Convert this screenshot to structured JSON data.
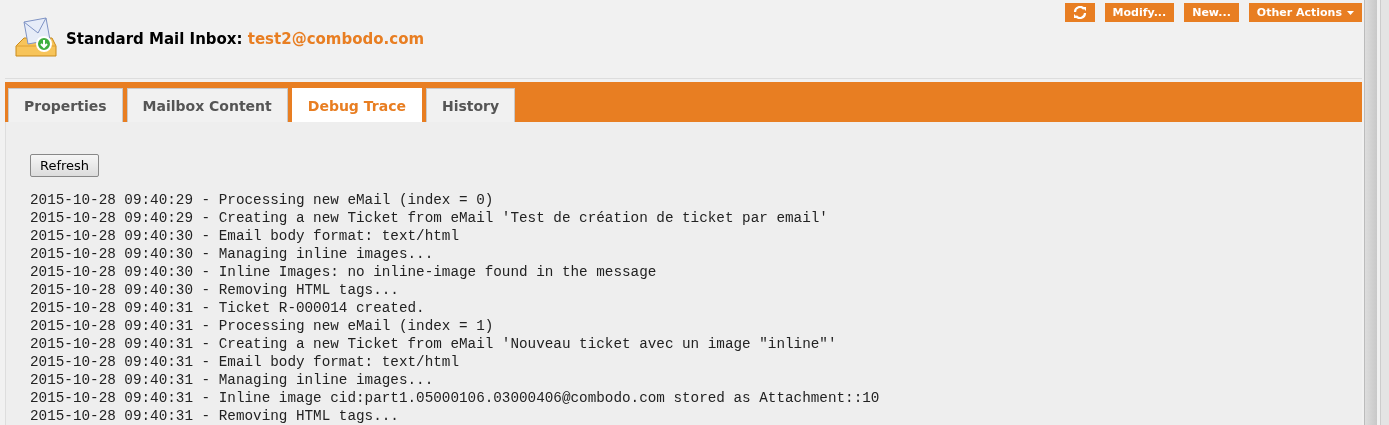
{
  "header": {
    "title_label": "Standard Mail Inbox:",
    "title_value": "test2@combodo.com"
  },
  "actions": [
    {
      "kind": "refresh"
    },
    {
      "kind": "text",
      "label": "Modify..."
    },
    {
      "kind": "text",
      "label": "New..."
    },
    {
      "kind": "menu",
      "label": "Other Actions"
    }
  ],
  "tabs": [
    {
      "label": "Properties",
      "selected": false
    },
    {
      "label": "Mailbox Content",
      "selected": false
    },
    {
      "label": "Debug Trace",
      "selected": true
    },
    {
      "label": "History",
      "selected": false
    }
  ],
  "refresh_button": "Refresh",
  "log_lines": [
    "2015-10-28 09:40:29 - Processing new eMail (index = 0)",
    "2015-10-28 09:40:29 - Creating a new Ticket from eMail 'Test de création de ticket par email'",
    "2015-10-28 09:40:30 - Email body format: text/html",
    "2015-10-28 09:40:30 - Managing inline images...",
    "2015-10-28 09:40:30 - Inline Images: no inline-image found in the message",
    "2015-10-28 09:40:30 - Removing HTML tags...",
    "2015-10-28 09:40:31 - Ticket R-000014 created.",
    "2015-10-28 09:40:31 - Processing new eMail (index = 1)",
    "2015-10-28 09:40:31 - Creating a new Ticket from eMail 'Nouveau ticket avec un image \"inline\"'",
    "2015-10-28 09:40:31 - Email body format: text/html",
    "2015-10-28 09:40:31 - Managing inline images...",
    "2015-10-28 09:40:31 - Inline image cid:part1.05000106.03000406@combodo.com stored as Attachment::10",
    "2015-10-28 09:40:31 - Removing HTML tags..."
  ]
}
